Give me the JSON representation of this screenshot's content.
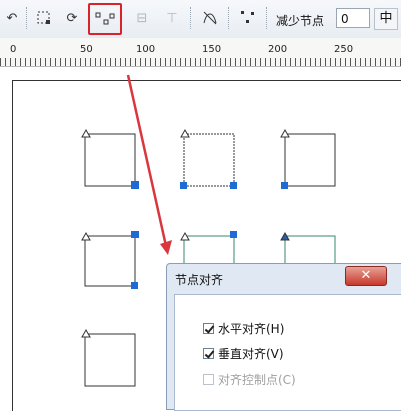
{
  "toolbar": {
    "reduce_nodes_label": "减少节点",
    "reduce_nodes_value": "0",
    "stepper_symbol": "中"
  },
  "ruler": {
    "labels": [
      "0",
      "50",
      "100",
      "150",
      "200",
      "250"
    ]
  },
  "dialog": {
    "title": "节点对齐",
    "close_symbol": "✕",
    "options": [
      {
        "label": "水平对齐(H)",
        "checked": true,
        "enabled": true
      },
      {
        "label": "垂直对齐(V)",
        "checked": true,
        "enabled": true
      },
      {
        "label": "对齐控制点(C)",
        "checked": false,
        "enabled": false
      }
    ]
  },
  "icons": [
    "undo-icon",
    "node-select-icon",
    "rotate-icon",
    "align-nodes-icon",
    "horizontal-align-icon",
    "vertical-align-icon",
    "smooth-node-icon",
    "scatter-node-icon"
  ],
  "colors": {
    "highlight": "#d9232a",
    "arrow": "#d9363e",
    "node_fill": "#1e6bd6"
  }
}
